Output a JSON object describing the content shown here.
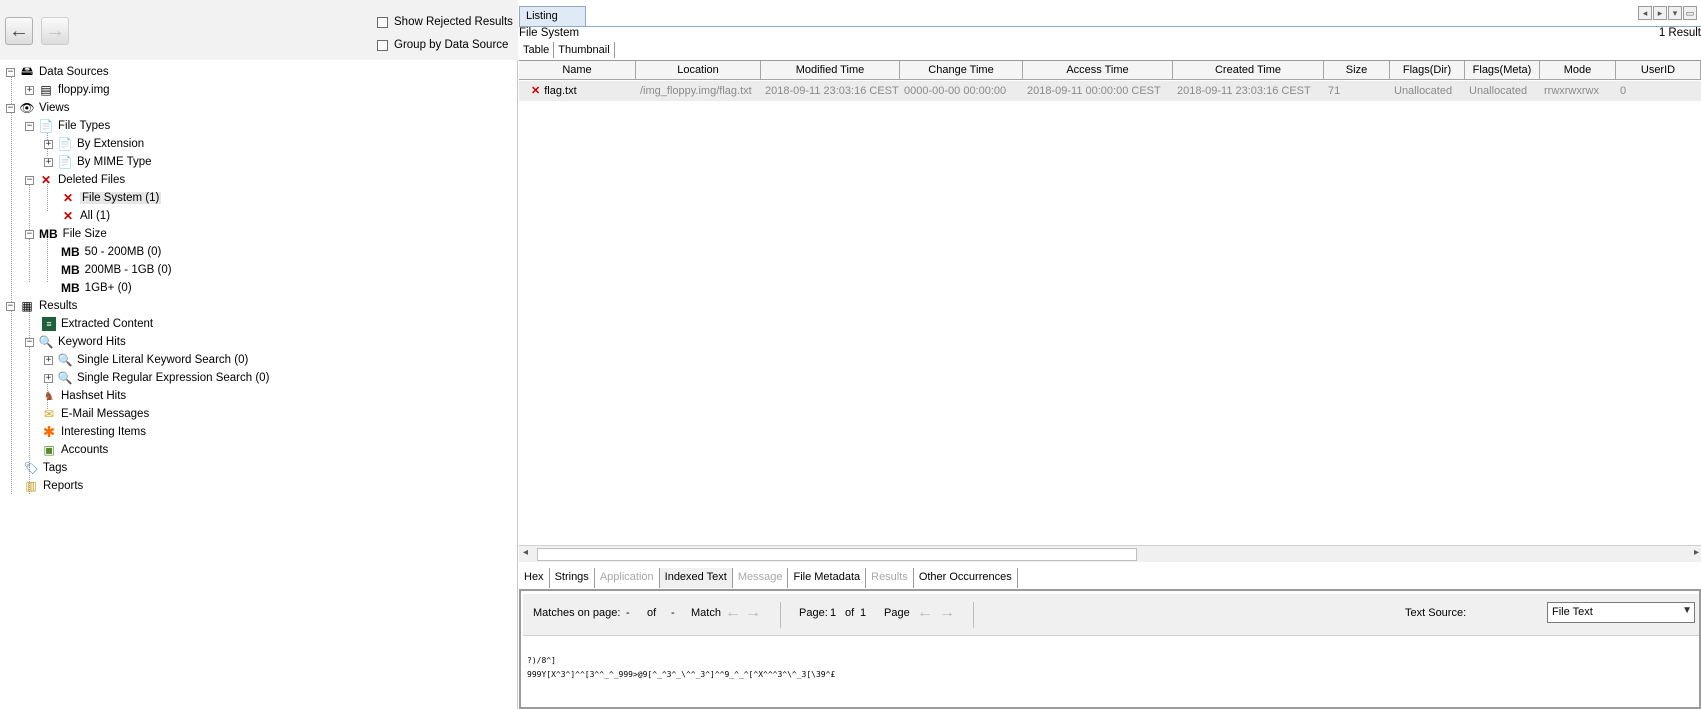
{
  "left": {
    "show_rejected": "Show Rejected Results",
    "group_by_source": "Group by Data Source",
    "tree": {
      "data_sources": "Data Sources",
      "floppy": "floppy.img",
      "views": "Views",
      "file_types": "File Types",
      "by_extension": "By Extension",
      "by_mime": "By MIME Type",
      "deleted_files": "Deleted Files",
      "file_system": "File System (1)",
      "all": "All (1)",
      "mb": "MB",
      "file_size": "File Size",
      "size_50_200": "50 - 200MB (0)",
      "size_200_1gb": "200MB - 1GB (0)",
      "size_1gb": "1GB+ (0)",
      "results": "Results",
      "extracted_content": "Extracted Content",
      "keyword_hits": "Keyword Hits",
      "single_literal": "Single Literal Keyword Search (0)",
      "single_regex": "Single Regular Expression Search (0)",
      "hashset_hits": "Hashset Hits",
      "email_messages": "E-Mail Messages",
      "interesting_items": "Interesting Items",
      "accounts": "Accounts",
      "tags": "Tags",
      "reports": "Reports"
    }
  },
  "listing": {
    "tab": "Listing",
    "path": "File System",
    "count": "1 Result",
    "view_tabs": [
      "Table",
      "Thumbnail"
    ],
    "columns": [
      "Name",
      "Location",
      "Modified Time",
      "Change Time",
      "Access Time",
      "Created Time",
      "Size",
      "Flags(Dir)",
      "Flags(Meta)",
      "Mode",
      "UserID"
    ],
    "row": {
      "name": "flag.txt",
      "location": "/img_floppy.img/flag.txt",
      "modified": "2018-09-11 23:03:16 CEST",
      "change": "0000-00-00 00:00:00",
      "access": "2018-09-11 00:00:00 CEST",
      "created": "2018-09-11 23:03:16 CEST",
      "size": "71",
      "flags_dir": "Unallocated",
      "flags_meta": "Unallocated",
      "mode": "rrwxrwxrwx",
      "userid": "0"
    }
  },
  "viewer": {
    "tabs": [
      "Hex",
      "Strings",
      "Application",
      "Indexed Text",
      "Message",
      "File Metadata",
      "Results",
      "Other Occurrences"
    ],
    "matches_label": "Matches on page:",
    "matches_cur": "-",
    "of": "of",
    "matches_total": "-",
    "match": "Match",
    "page_label": "Page:",
    "page_cur": "1",
    "page_of": "of",
    "page_total": "1",
    "page": "Page",
    "text_source_label": "Text Source:",
    "text_source_value": "File Text",
    "text_line1": "?)/8^]",
    "text_line2": "999Y[X^3^]^^[3^^_^_999>@9[^_^3^_\\^^_3^]^^9_^_^[^X^^^3^\\^_3[\\39^£"
  }
}
